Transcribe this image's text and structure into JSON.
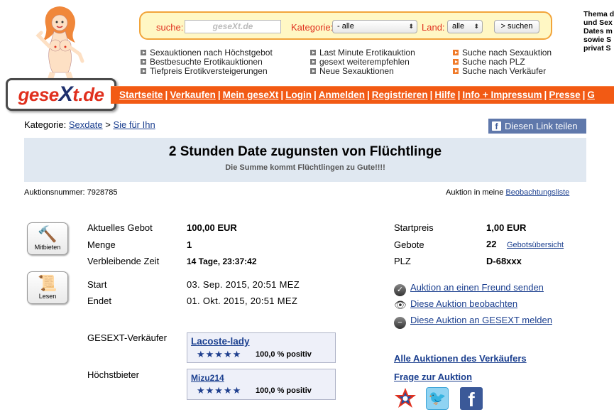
{
  "logo": {
    "text_pre": "gese",
    "text_x": "X",
    "text_post": "t.de"
  },
  "search": {
    "label": "suche:",
    "placeholder": "geseXt.de",
    "category_label": "Kategorie:",
    "category_value": "- alle",
    "country_label": "Land:",
    "country_value": "alle",
    "submit": "> suchen"
  },
  "quicklinks": {
    "col1": [
      "Sexauktionen nach Höchstgebot",
      "Bestbesuchte Erotikauktionen",
      "Tiefpreis Erotikversteigerungen"
    ],
    "col2": [
      "Last Minute Erotikauktion",
      "gesext weiterempfehlen",
      "Neue Sexauktionen"
    ],
    "col3": [
      "Suche nach Sexauktion",
      "Suche nach PLZ",
      "Suche nach Verkäufer"
    ]
  },
  "sidetext": [
    "Thema d",
    "und Sex",
    "Dates m",
    "sowie S",
    "privat S"
  ],
  "nav": [
    "Startseite",
    "Verkaufen",
    "Mein geseXt",
    "Login",
    "Anmelden",
    "Registrieren",
    "Hilfe",
    "Info + Impressum",
    "Presse",
    "G"
  ],
  "breadcrumb": {
    "prefix": "Kategorie:",
    "cat": "Sexdate",
    "sep": ">",
    "sub": "Sie für Ihn"
  },
  "share": {
    "icon": "f",
    "label": "Diesen Link teilen"
  },
  "auction": {
    "title": "2 Stunden Date zugunsten von Flüchtlinge",
    "subtitle": "Die Summe kommt Flüchtlingen zu Gute!!!!",
    "number_label": "Auktionsnummer: 7928785",
    "watch_prefix": "Auktion in meine",
    "watch_link": "Beobachtungsliste"
  },
  "buttons": {
    "bid": "Mitbieten",
    "read": "Lesen"
  },
  "details": {
    "current_bid_label": "Aktuelles Gebot",
    "current_bid": "100,00 EUR",
    "qty_label": "Menge",
    "qty": "1",
    "remaining_label": "Verbleibende Zeit",
    "remaining": "14 Tage, 23:37:42",
    "start_label": "Start",
    "start": "03. Sep. 2015, 20:51 MEZ",
    "end_label": "Endet",
    "end": "01. Okt. 2015, 20:51 MEZ",
    "seller_label": "GESEXT-Verkäufer",
    "seller_name": "Lacoste-lady",
    "seller_rating": "100,0 % positiv",
    "bidder_label": "Höchstbieter",
    "bidder_name": "Mizu214",
    "bidder_rating": "100,0 % positiv",
    "stars": "★★★★★"
  },
  "right": {
    "startprice_label": "Startpreis",
    "startprice": "1,00 EUR",
    "bids_label": "Gebote",
    "bids": "22",
    "bids_link": "Gebotsübersicht",
    "plz_label": "PLZ",
    "plz": "D-68xxx",
    "action1": "Auktion an einen Freund senden",
    "action2": "Diese Auktion beobachten",
    "action3": "Diese Auktion an GESEXT melden",
    "all_auctions": "Alle Auktionen des Verkäufers",
    "question": "Frage zur Auktion"
  },
  "colors": {
    "brand_orange": "#f25a14",
    "brand_red": "#e0301e",
    "title_bg": "#e0e8f1",
    "link": "#1b3f8f"
  }
}
